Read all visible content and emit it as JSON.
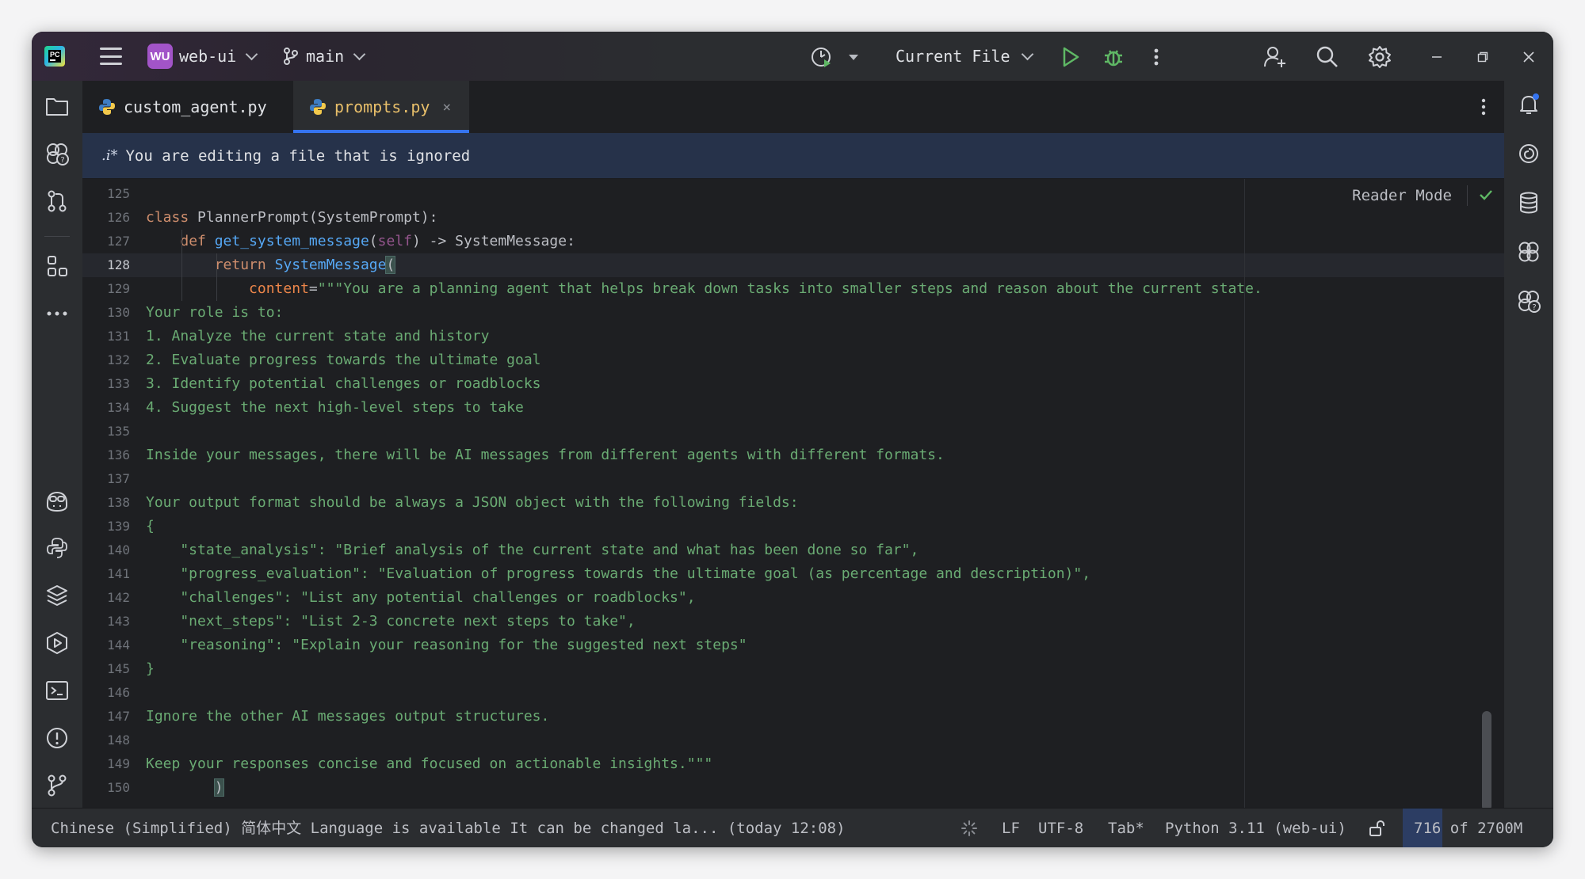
{
  "titlebar": {
    "project_badge": "WU",
    "project_name": "web-ui",
    "branch": "main",
    "run_config": "Current File",
    "icons": [
      "app-icon",
      "hamburger-menu-icon",
      "branch-icon",
      "profiler-icon",
      "run-icon",
      "debug-icon",
      "more-vertical-icon",
      "add-user-icon",
      "search-icon",
      "settings-gear-icon",
      "minimize-icon",
      "restore-icon",
      "close-icon"
    ]
  },
  "tabs": [
    {
      "label": "custom_agent.py",
      "active": false
    },
    {
      "label": "prompts.py",
      "active": true,
      "close": "×"
    }
  ],
  "banner": {
    "icon_text": ".i*",
    "text": "You are editing a file that is ignored"
  },
  "editor": {
    "reader_mode": "Reader Mode",
    "current_line": 128,
    "lines": [
      {
        "n": "125",
        "text": ""
      },
      {
        "n": "126",
        "text": "class PlannerPrompt(SystemPrompt):"
      },
      {
        "n": "127",
        "text": "    def get_system_message(self) -> SystemMessage:"
      },
      {
        "n": "128",
        "text": "        return SystemMessage("
      },
      {
        "n": "129",
        "text": "            content=\"\"\"You are a planning agent that helps break down tasks into smaller steps and reason about the current state."
      },
      {
        "n": "130",
        "text": "Your role is to:"
      },
      {
        "n": "131",
        "text": "1. Analyze the current state and history"
      },
      {
        "n": "132",
        "text": "2. Evaluate progress towards the ultimate goal"
      },
      {
        "n": "133",
        "text": "3. Identify potential challenges or roadblocks"
      },
      {
        "n": "134",
        "text": "4. Suggest the next high-level steps to take"
      },
      {
        "n": "135",
        "text": ""
      },
      {
        "n": "136",
        "text": "Inside your messages, there will be AI messages from different agents with different formats."
      },
      {
        "n": "137",
        "text": ""
      },
      {
        "n": "138",
        "text": "Your output format should be always a JSON object with the following fields:"
      },
      {
        "n": "139",
        "text": "{"
      },
      {
        "n": "140",
        "text": "    \"state_analysis\": \"Brief analysis of the current state and what has been done so far\","
      },
      {
        "n": "141",
        "text": "    \"progress_evaluation\": \"Evaluation of progress towards the ultimate goal (as percentage and description)\","
      },
      {
        "n": "142",
        "text": "    \"challenges\": \"List any potential challenges or roadblocks\","
      },
      {
        "n": "143",
        "text": "    \"next_steps\": \"List 2-3 concrete next steps to take\","
      },
      {
        "n": "144",
        "text": "    \"reasoning\": \"Explain your reasoning for the suggested next steps\""
      },
      {
        "n": "145",
        "text": "}"
      },
      {
        "n": "146",
        "text": ""
      },
      {
        "n": "147",
        "text": "Ignore the other AI messages output structures."
      },
      {
        "n": "148",
        "text": ""
      },
      {
        "n": "149",
        "text": "Keep your responses concise and focused on actionable insights.\"\"\""
      },
      {
        "n": "150",
        "text": "        )"
      }
    ]
  },
  "statusbar": {
    "message": "Chinese (Simplified) 简体中文 Language is available It can be changed la... (today 12:08)",
    "line_sep": "LF",
    "encoding": "UTF-8",
    "indent": "Tab*",
    "interpreter": "Python 3.11 (web-ui)",
    "memory": "716 of 2700M",
    "memory_fraction": 0.265
  },
  "colors": {
    "keyword": "#cf8e6d",
    "function": "#56a8f5",
    "string": "#6aab73",
    "self": "#94558d",
    "param": "#ed864a",
    "accent": "#3574f0",
    "active_tab_text": "#e8bf6a"
  }
}
